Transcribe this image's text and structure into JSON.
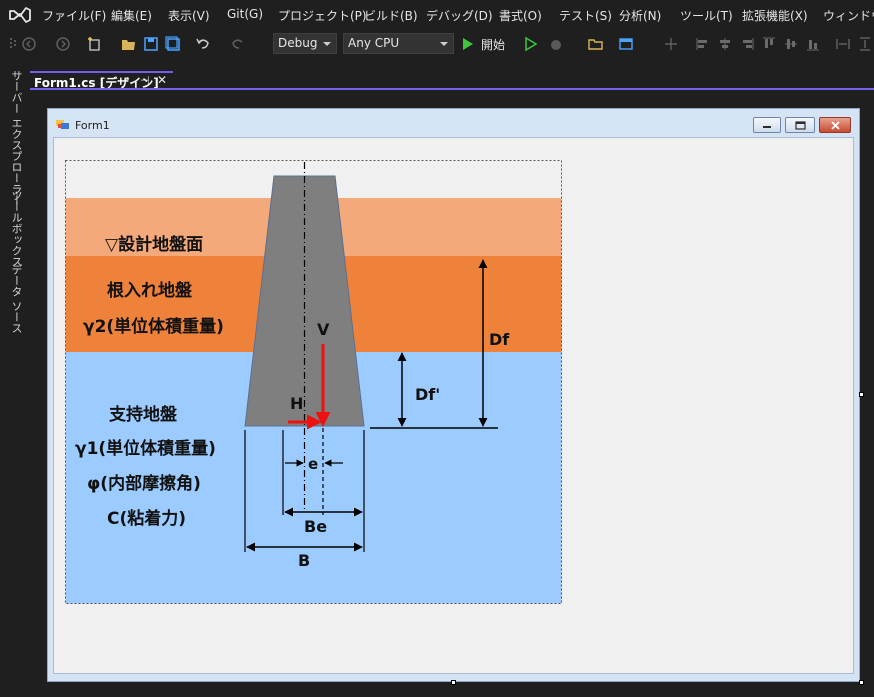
{
  "menu": {
    "items": [
      "ファイル(F)",
      "編集(E)",
      "表示(V)",
      "Git(G)",
      "プロジェクト(P)",
      "ビルド(B)",
      "デバッグ(D)",
      "書式(O)",
      "テスト(S)",
      "分析(N)",
      "ツール(T)",
      "拡張機能(X)",
      "ウィンドウ(W)"
    ]
  },
  "toolbar": {
    "config": "Debug",
    "platform": "Any CPU",
    "start_label": "開始"
  },
  "side_tabs": [
    "サーバー エクスプローラー",
    "ツールボックス",
    "データ ソース"
  ],
  "document_tab": {
    "label": "Form1.cs [デザイン]",
    "pin": "⊣",
    "close": "✕"
  },
  "form": {
    "title": "Form1",
    "diagram": {
      "label_design_ground": "▽設計地盤面",
      "label_embed_1": "根入れ地盤",
      "label_embed_2": "γ2(単位体積重量)",
      "label_support_1": "支持地盤",
      "label_support_2": "γ1(単位体積重量)",
      "label_support_3": "φ(内部摩擦角)",
      "label_support_4": "C(粘着力)",
      "label_V": "V",
      "label_H": "H",
      "label_e": "e",
      "label_Be": "Be",
      "label_B": "B",
      "label_Df": "Df",
      "label_Dfp": "Df'"
    }
  },
  "colors": {
    "accent": "#7160e8",
    "layer_design_ground": "#f4a97a",
    "layer_embedment": "#ee823a",
    "layer_support": "#9bcbff",
    "footing": "#7f7f7f",
    "force": "#ee1111"
  }
}
